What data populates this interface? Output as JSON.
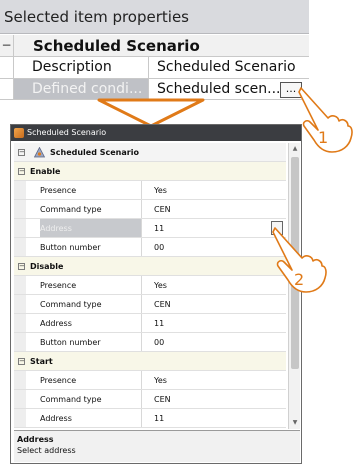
{
  "top_panel": {
    "header": "Selected item properties",
    "title": "Scheduled Scenario",
    "description_label": "Description",
    "description_value": "Scheduled Scenario",
    "defined_label": "Defined condi...",
    "defined_value": "Scheduled scen...",
    "dots_label": "..."
  },
  "callouts": {
    "one": "1",
    "two": "2"
  },
  "dialog": {
    "title": "Scheduled Scenario",
    "root_label": "Scheduled Scenario",
    "sections": [
      {
        "name": "Enable",
        "rows": [
          {
            "name": "Presence",
            "value": "Yes"
          },
          {
            "name": "Command type",
            "value": "CEN"
          },
          {
            "name": "Address",
            "value": "11"
          },
          {
            "name": "Button number",
            "value": "00"
          }
        ]
      },
      {
        "name": "Disable",
        "rows": [
          {
            "name": "Presence",
            "value": "Yes"
          },
          {
            "name": "Command type",
            "value": "CEN"
          },
          {
            "name": "Address",
            "value": "11"
          },
          {
            "name": "Button number",
            "value": "00"
          }
        ]
      },
      {
        "name": "Start",
        "rows": [
          {
            "name": "Presence",
            "value": "Yes"
          },
          {
            "name": "Command type",
            "value": "CEN"
          },
          {
            "name": "Address",
            "value": "11"
          }
        ]
      }
    ],
    "help_title": "Address",
    "help_text": "Select address"
  },
  "colors": {
    "accent_orange": "#e07a18",
    "title_bar": "#3b3d41",
    "category_bg": "#f8f7e8",
    "selected_bg": "#c7c9cd"
  }
}
